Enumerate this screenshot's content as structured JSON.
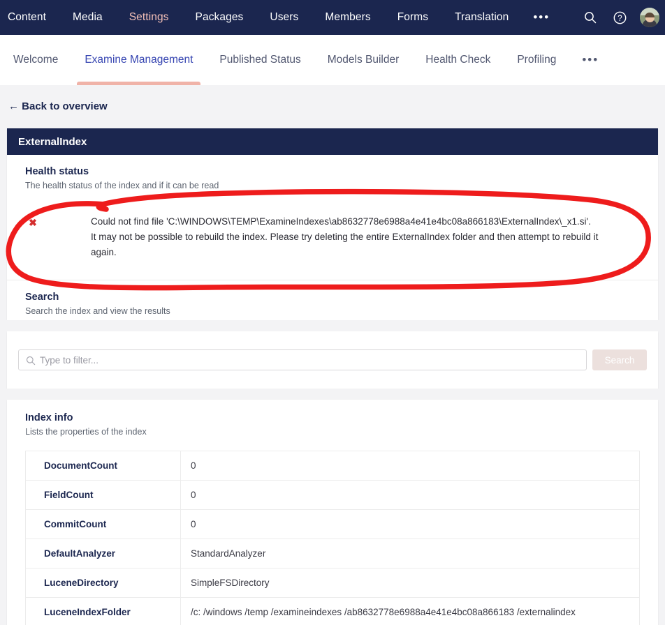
{
  "topnav": {
    "items": [
      {
        "label": "Content",
        "active": false
      },
      {
        "label": "Media",
        "active": false
      },
      {
        "label": "Settings",
        "active": true
      },
      {
        "label": "Packages",
        "active": false
      },
      {
        "label": "Users",
        "active": false
      },
      {
        "label": "Members",
        "active": false
      },
      {
        "label": "Forms",
        "active": false
      },
      {
        "label": "Translation",
        "active": false
      }
    ],
    "overflow": "•••",
    "icons": {
      "search": "search-icon",
      "help": "help-icon",
      "avatar": "user-avatar"
    },
    "accent": "#f5c1b8",
    "background": "#1b264f"
  },
  "subnav": {
    "items": [
      {
        "label": "Welcome",
        "active": false
      },
      {
        "label": "Examine Management",
        "active": true
      },
      {
        "label": "Published Status",
        "active": false
      },
      {
        "label": "Models Builder",
        "active": false
      },
      {
        "label": "Health Check",
        "active": false
      },
      {
        "label": "Profiling",
        "active": false
      }
    ],
    "overflow": "•••",
    "active_color": "#3544b1",
    "underline_color": "#f0b3a8"
  },
  "back_link": "← Back to overview",
  "panel": {
    "title": "ExternalIndex",
    "health": {
      "title": "Health status",
      "description": "The health status of the index and if it can be read",
      "status_icon": "error-cross-icon",
      "status_color": "#d42e2e",
      "message": "Could not find file 'C:\\WINDOWS\\TEMP\\ExamineIndexes\\ab8632778e6988a4e41e4bc08a866183\\ExternalIndex\\_x1.si'.\nIt may not be possible to rebuild the index. Please try deleting the entire ExternalIndex folder and then attempt to rebuild it\nagain."
    },
    "search": {
      "title": "Search",
      "description": "Search the index and view the results",
      "input_placeholder": "Type to filter...",
      "input_value": "",
      "input_icon": "search-icon",
      "button_label": "Search",
      "button_disabled": true
    },
    "index_info": {
      "title": "Index info",
      "description": "Lists the properties of the index",
      "rows": [
        {
          "key": "DocumentCount",
          "value": "0"
        },
        {
          "key": "FieldCount",
          "value": "0"
        },
        {
          "key": "CommitCount",
          "value": "0"
        },
        {
          "key": "DefaultAnalyzer",
          "value": "StandardAnalyzer"
        },
        {
          "key": "LuceneDirectory",
          "value": "SimpleFSDirectory"
        },
        {
          "key": "LuceneIndexFolder",
          "value": "/c: /windows /temp /examineindexes /ab8632778e6988a4e41e4bc08a866183 /externalindex"
        }
      ]
    }
  },
  "annotation": {
    "shape": "hand-drawn-ellipse",
    "color": "#ee1c1c",
    "target": "health-status-error-message"
  }
}
